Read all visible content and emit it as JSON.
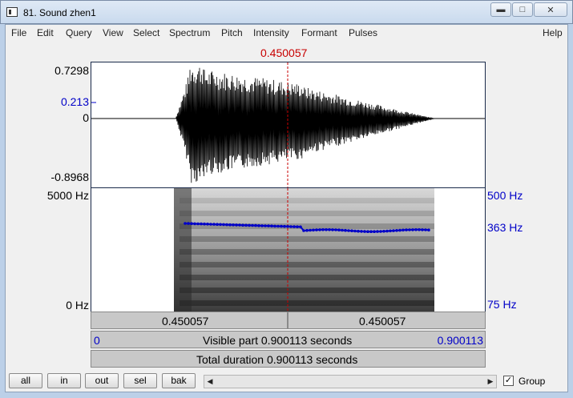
{
  "window": {
    "title": "81. Sound zhen1",
    "controls": [
      "minimize",
      "maximize",
      "close"
    ]
  },
  "menu": {
    "items": [
      "File",
      "Edit",
      "Query",
      "View",
      "Select",
      "Spectrum",
      "Pitch",
      "Intensity",
      "Formant",
      "Pulses"
    ],
    "help": "Help"
  },
  "cursor": {
    "time": "0.450057",
    "fraction": 0.5
  },
  "waveform": {
    "max": "0.7298",
    "cursor_value": "0.213",
    "zero": "0",
    "min": "-0.8968"
  },
  "spectrogram": {
    "top_left": "5000 Hz",
    "bottom_left": "0 Hz",
    "pitch_top": "500 Hz",
    "pitch_value": "363 Hz",
    "pitch_bottom": "75 Hz"
  },
  "bars": {
    "left_selection": "0.450057",
    "right_selection": "0.450057",
    "visible_start": "0",
    "visible_text": "Visible part 0.900113 seconds",
    "visible_end": "0.900113",
    "total_text": "Total duration 0.900113 seconds"
  },
  "toolbar": {
    "all": "all",
    "in": "in",
    "out": "out",
    "sel": "sel",
    "bak": "bak",
    "group_label": "Group",
    "group_checked": true
  },
  "colors": {
    "cursor": "#c80000",
    "pitch": "#0000c8",
    "waveform": "#000000"
  }
}
